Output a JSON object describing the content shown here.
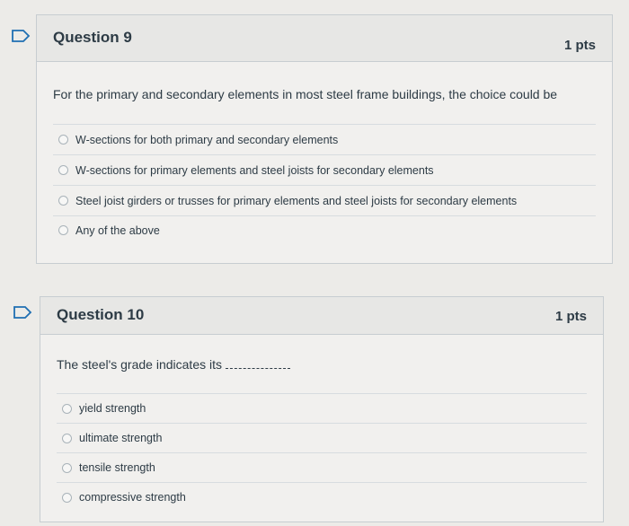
{
  "q9": {
    "title": "Question 9",
    "points": "1 pts",
    "prompt": "For the primary and secondary elements in most steel frame buildings, the choice could be",
    "answers": [
      "W-sections for both primary and secondary elements",
      "W-sections for primary elements and steel joists for secondary elements",
      "Steel joist girders or trusses for primary elements and steel joists for secondary elements",
      "Any of the above"
    ]
  },
  "q10": {
    "title": "Question 10",
    "points": "1 pts",
    "prompt": "The steel's grade indicates its",
    "answers": [
      "yield strength",
      "ultimate strength",
      "tensile strength",
      "compressive strength"
    ]
  },
  "colors": {
    "text": "#2d3b45",
    "border": "#c7cdd1",
    "header_bg": "#e7e7e5",
    "flag": "#1f6fb2"
  },
  "icons": [
    "flag-question-icon",
    "radio-button-icon"
  ]
}
